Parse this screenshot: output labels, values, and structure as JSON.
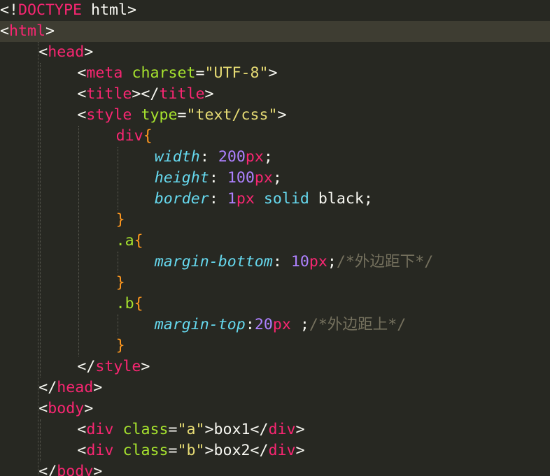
{
  "editor": {
    "theme_colors": {
      "background": "#272822",
      "current_line": "#3e3d32",
      "tag": "#f92672",
      "attribute": "#a6e22e",
      "string": "#e6db74",
      "property": "#66d9ef",
      "number": "#ae81ff",
      "comment": "#75715e",
      "brace": "#fd971f",
      "text": "#f8f8f2"
    },
    "current_line_index": 1,
    "lines": [
      {
        "indent": 0,
        "tokens": [
          {
            "t": "punc",
            "v": "<!"
          },
          {
            "t": "tag",
            "v": "DOCTYPE"
          },
          {
            "t": "text",
            "v": " html"
          },
          {
            "t": "punc",
            "v": ">"
          }
        ]
      },
      {
        "indent": 0,
        "tokens": [
          {
            "t": "punc",
            "v": "<"
          },
          {
            "t": "tag",
            "v": "html"
          },
          {
            "t": "punc",
            "v": ">"
          }
        ]
      },
      {
        "indent": 1,
        "tokens": [
          {
            "t": "punc",
            "v": "<"
          },
          {
            "t": "tag",
            "v": "head"
          },
          {
            "t": "punc",
            "v": ">"
          }
        ]
      },
      {
        "indent": 2,
        "tokens": [
          {
            "t": "punc",
            "v": "<"
          },
          {
            "t": "tag",
            "v": "meta"
          },
          {
            "t": "text",
            "v": " "
          },
          {
            "t": "attr",
            "v": "charset"
          },
          {
            "t": "punc",
            "v": "="
          },
          {
            "t": "str",
            "v": "\"UTF-8\""
          },
          {
            "t": "punc",
            "v": ">"
          }
        ]
      },
      {
        "indent": 2,
        "tokens": [
          {
            "t": "punc",
            "v": "<"
          },
          {
            "t": "tag",
            "v": "title"
          },
          {
            "t": "punc",
            "v": "></"
          },
          {
            "t": "tag",
            "v": "title"
          },
          {
            "t": "punc",
            "v": ">"
          }
        ]
      },
      {
        "indent": 2,
        "tokens": [
          {
            "t": "punc",
            "v": "<"
          },
          {
            "t": "tag",
            "v": "style"
          },
          {
            "t": "text",
            "v": " "
          },
          {
            "t": "attr",
            "v": "type"
          },
          {
            "t": "punc",
            "v": "="
          },
          {
            "t": "str",
            "v": "\"text/css\""
          },
          {
            "t": "punc",
            "v": ">"
          }
        ]
      },
      {
        "indent": 3,
        "tokens": [
          {
            "t": "tag",
            "v": "div"
          },
          {
            "t": "brace",
            "v": "{"
          }
        ]
      },
      {
        "indent": 4,
        "tokens": [
          {
            "t": "prop",
            "v": "width"
          },
          {
            "t": "punc",
            "v": ": "
          },
          {
            "t": "num",
            "v": "200"
          },
          {
            "t": "unit",
            "v": "px"
          },
          {
            "t": "punc",
            "v": ";"
          }
        ]
      },
      {
        "indent": 4,
        "tokens": [
          {
            "t": "prop",
            "v": "height"
          },
          {
            "t": "punc",
            "v": ": "
          },
          {
            "t": "num",
            "v": "100"
          },
          {
            "t": "unit",
            "v": "px"
          },
          {
            "t": "punc",
            "v": ";"
          }
        ]
      },
      {
        "indent": 4,
        "tokens": [
          {
            "t": "prop",
            "v": "border"
          },
          {
            "t": "punc",
            "v": ": "
          },
          {
            "t": "num",
            "v": "1"
          },
          {
            "t": "unit",
            "v": "px"
          },
          {
            "t": "text",
            "v": " "
          },
          {
            "t": "val",
            "v": "solid"
          },
          {
            "t": "text",
            "v": " black"
          },
          {
            "t": "punc",
            "v": ";"
          }
        ]
      },
      {
        "indent": 3,
        "tokens": [
          {
            "t": "brace",
            "v": "}"
          }
        ]
      },
      {
        "indent": 3,
        "tokens": [
          {
            "t": "sel",
            "v": ".a"
          },
          {
            "t": "brace",
            "v": "{"
          }
        ]
      },
      {
        "indent": 4,
        "tokens": [
          {
            "t": "prop",
            "v": "margin-bottom"
          },
          {
            "t": "punc",
            "v": ": "
          },
          {
            "t": "num",
            "v": "10"
          },
          {
            "t": "unit",
            "v": "px"
          },
          {
            "t": "punc",
            "v": ";"
          },
          {
            "t": "comment",
            "v": "/*外边距下*/"
          }
        ]
      },
      {
        "indent": 3,
        "tokens": [
          {
            "t": "brace",
            "v": "}"
          }
        ]
      },
      {
        "indent": 3,
        "tokens": [
          {
            "t": "sel",
            "v": ".b"
          },
          {
            "t": "brace",
            "v": "{"
          }
        ]
      },
      {
        "indent": 4,
        "tokens": [
          {
            "t": "prop",
            "v": "margin-top"
          },
          {
            "t": "punc",
            "v": ":"
          },
          {
            "t": "num",
            "v": "20"
          },
          {
            "t": "unit",
            "v": "px"
          },
          {
            "t": "text",
            "v": " "
          },
          {
            "t": "punc",
            "v": ";"
          },
          {
            "t": "comment",
            "v": "/*外边距上*/"
          }
        ]
      },
      {
        "indent": 3,
        "tokens": [
          {
            "t": "brace",
            "v": "}"
          }
        ]
      },
      {
        "indent": 2,
        "tokens": [
          {
            "t": "punc",
            "v": "</"
          },
          {
            "t": "tag",
            "v": "style"
          },
          {
            "t": "punc",
            "v": ">"
          }
        ]
      },
      {
        "indent": 1,
        "tokens": [
          {
            "t": "punc",
            "v": "</"
          },
          {
            "t": "tag",
            "v": "head"
          },
          {
            "t": "punc",
            "v": ">"
          }
        ]
      },
      {
        "indent": 1,
        "tokens": [
          {
            "t": "punc",
            "v": "<"
          },
          {
            "t": "tag",
            "v": "body"
          },
          {
            "t": "punc",
            "v": ">"
          }
        ]
      },
      {
        "indent": 2,
        "tokens": [
          {
            "t": "punc",
            "v": "<"
          },
          {
            "t": "tag",
            "v": "div"
          },
          {
            "t": "text",
            "v": " "
          },
          {
            "t": "attr",
            "v": "class"
          },
          {
            "t": "punc",
            "v": "="
          },
          {
            "t": "str",
            "v": "\"a\""
          },
          {
            "t": "punc",
            "v": ">"
          },
          {
            "t": "text",
            "v": "box1"
          },
          {
            "t": "punc",
            "v": "</"
          },
          {
            "t": "tag",
            "v": "div"
          },
          {
            "t": "punc",
            "v": ">"
          }
        ]
      },
      {
        "indent": 2,
        "tokens": [
          {
            "t": "punc",
            "v": "<"
          },
          {
            "t": "tag",
            "v": "div"
          },
          {
            "t": "text",
            "v": " "
          },
          {
            "t": "attr",
            "v": "class"
          },
          {
            "t": "punc",
            "v": "="
          },
          {
            "t": "str",
            "v": "\"b\""
          },
          {
            "t": "punc",
            "v": ">"
          },
          {
            "t": "text",
            "v": "box2"
          },
          {
            "t": "punc",
            "v": "</"
          },
          {
            "t": "tag",
            "v": "div"
          },
          {
            "t": "punc",
            "v": ">"
          }
        ]
      },
      {
        "indent": 1,
        "tokens": [
          {
            "t": "punc",
            "v": "</"
          },
          {
            "t": "tag",
            "v": "body"
          },
          {
            "t": "punc",
            "v": ">"
          }
        ]
      }
    ]
  }
}
